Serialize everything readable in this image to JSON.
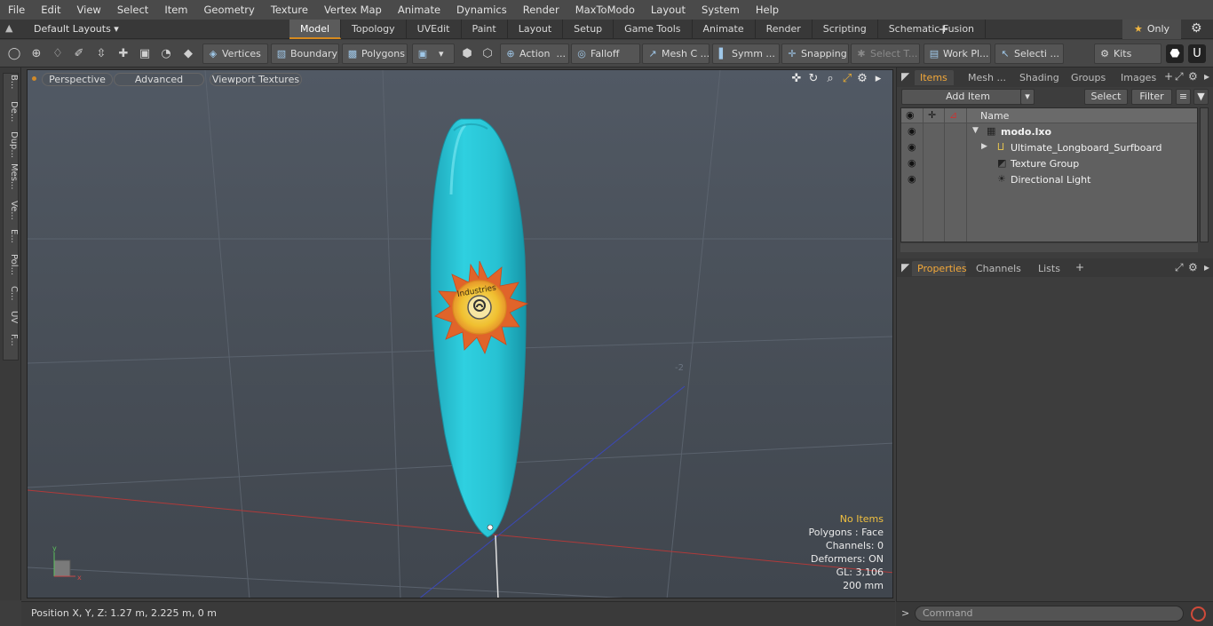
{
  "menu": [
    "File",
    "Edit",
    "View",
    "Select",
    "Item",
    "Geometry",
    "Texture",
    "Vertex Map",
    "Animate",
    "Dynamics",
    "Render",
    "MaxToModo",
    "Layout",
    "System",
    "Help"
  ],
  "layoutbar": {
    "layouts_label": "Default Layouts ▾",
    "tabs": [
      "Model",
      "Topology",
      "UVEdit",
      "Paint",
      "Layout",
      "Setup",
      "Game Tools",
      "Animate",
      "Render",
      "Scripting",
      "Schematic Fusion"
    ],
    "only_label": "Only"
  },
  "toolbar": {
    "vertices": "Vertices",
    "boundary": "Boundary",
    "polygons": "Polygons",
    "action": "Action",
    "falloff": "Falloff",
    "mesh": "Mesh C ...",
    "symm": "Symm ...",
    "snapping": "Snapping",
    "select_t": "Select T...",
    "work_pl": "Work Pl...",
    "selecti": "Selecti ...",
    "kits": "Kits"
  },
  "left_tabs": [
    "B...",
    "De...",
    "Dup...",
    "Mes...",
    "Ve...",
    "E...",
    "Pol...",
    "C...",
    "UV",
    "F..."
  ],
  "viewport": {
    "perspective": "Perspective",
    "advanced": "Advanced",
    "textures": "Viewport Textures",
    "axis_label": "-2",
    "info": {
      "no_items": "No Items",
      "polygons": "Polygons : Face",
      "channels": "Channels: 0",
      "deformers": "Deformers: ON",
      "gl": "GL: 3,106",
      "unit": "200 mm"
    },
    "logo_text": "Industries",
    "accent_color": "#27c2d3"
  },
  "status": {
    "position": "Position X, Y, Z:   1.27 m, 2.225 m, 0 m"
  },
  "right": {
    "tabs_top": [
      "Items",
      "Mesh ...",
      "Shading",
      "Groups",
      "Images"
    ],
    "add_item": "Add Item",
    "select": "Select",
    "filter": "Filter",
    "name_header": "Name",
    "items": [
      {
        "name": "modo.lxo",
        "icon": "scene-icon"
      },
      {
        "name": "Ultimate_Longboard_Surfboard",
        "icon": "mesh-icon"
      },
      {
        "name": "Texture Group",
        "icon": "texture-group-icon"
      },
      {
        "name": "Directional Light",
        "icon": "light-icon"
      }
    ],
    "tabs_bottom": [
      "Properties",
      "Channels",
      "Lists"
    ],
    "command_placeholder": "Command"
  }
}
